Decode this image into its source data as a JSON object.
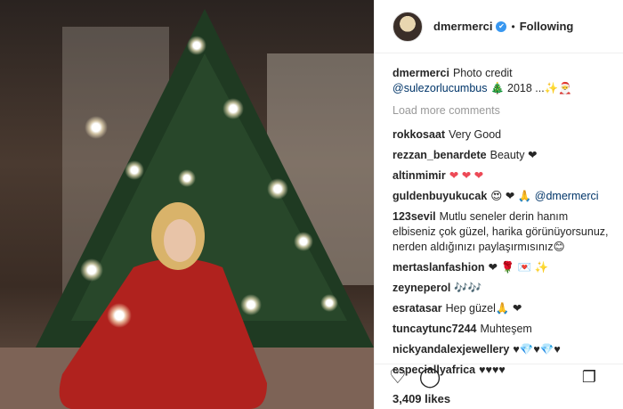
{
  "post": {
    "username": "dmermerci",
    "verified_mark": "✔",
    "separator": "•",
    "follow_state": "Following"
  },
  "caption": {
    "username": "dmermerci",
    "text_prefix": "Photo credit",
    "mention": "@sulezorlucumbus",
    "text_suffix": "🎄 2018 ...✨🎅"
  },
  "load_more": "Load more comments",
  "comments": [
    {
      "user": "rokkosaat",
      "text": "Very Good"
    },
    {
      "user": "rezzan_benardete",
      "text": "Beauty ❤"
    },
    {
      "user": "altinmimir",
      "text": "❤ ❤ ❤"
    },
    {
      "user": "guldenbuyukucak",
      "text": "😍 ❤ 🙏 ",
      "mention": "@dmermerci"
    },
    {
      "user": "123sevil",
      "text": "Mutlu seneler derin hanım elbiseniz çok güzel, harika görünüyorsunuz, nerden aldığınızı paylaşırmısınız😊"
    },
    {
      "user": "mertaslanfashion",
      "text": "❤ 🌹 💌 ✨"
    },
    {
      "user": "zeyneperol",
      "text": "🎶🎶"
    },
    {
      "user": "esratasar",
      "text": "Hep güzel🙏 ❤"
    },
    {
      "user": "tuncaytunc7244",
      "text": "Muhteşem"
    },
    {
      "user": "nickyandalexjewellery",
      "text": "♥💎♥💎♥"
    },
    {
      "user": "especiallyafrica",
      "text": "♥♥♥♥"
    }
  ],
  "actions": {
    "like_icon": "♡",
    "comment_icon": "◯",
    "share_icon": "▸",
    "bookmark_icon": "❐"
  },
  "likes": "3,409 likes"
}
